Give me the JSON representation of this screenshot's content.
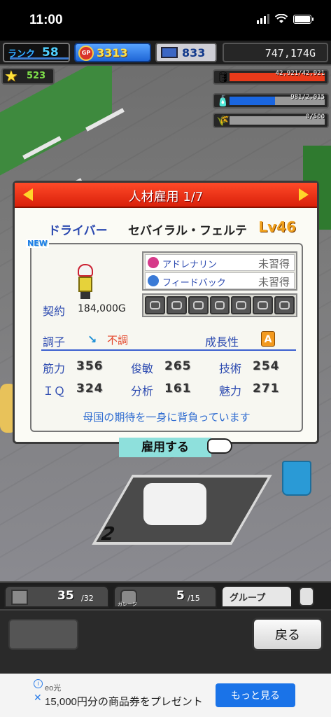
{
  "status_bar": {
    "time": "11:00"
  },
  "hud": {
    "rank_label": "ランク",
    "rank_value": "58",
    "gp_value": "3313",
    "gp_icon": "GP",
    "pc_value": "833",
    "money": "747,174G",
    "stars": "523",
    "fuel": "42,921/42,921",
    "water": "981/2,015",
    "wheat": "0/500"
  },
  "dialog": {
    "title": "人材雇用 1/7",
    "job": "ドライバー",
    "name": "セバイラル・フェルテ",
    "level": "Lv46",
    "new_badge": "NEW",
    "contract_label": "契約",
    "contract_value": "184,000G",
    "skills": [
      {
        "name": "アドレナリン",
        "status": "未習得"
      },
      {
        "name": "フィードバック",
        "status": "未習得"
      }
    ],
    "condition_label": "調子",
    "condition_value": "不調",
    "growth_label": "成長性",
    "growth_value": "A",
    "stats": [
      {
        "label": "筋力",
        "value": "356"
      },
      {
        "label": "俊敏",
        "value": "265"
      },
      {
        "label": "技術",
        "value": "254"
      },
      {
        "label": "ＩＱ",
        "value": "324"
      },
      {
        "label": "分析",
        "value": "161"
      },
      {
        "label": "魅力",
        "value": "271"
      }
    ],
    "motto": "母国の期待を一身に背負っています",
    "hire_button": "雇用する"
  },
  "tabs": {
    "people_value": "35",
    "people_max": "/32",
    "garage_value": "5",
    "garage_max": "/15",
    "garage_label": "ガレージ",
    "group_label": "グループ"
  },
  "back_button": "戻る",
  "ad": {
    "brand": "eo光",
    "text": "15,000円分の商品券をプレゼント",
    "cta": "もっと見る"
  }
}
